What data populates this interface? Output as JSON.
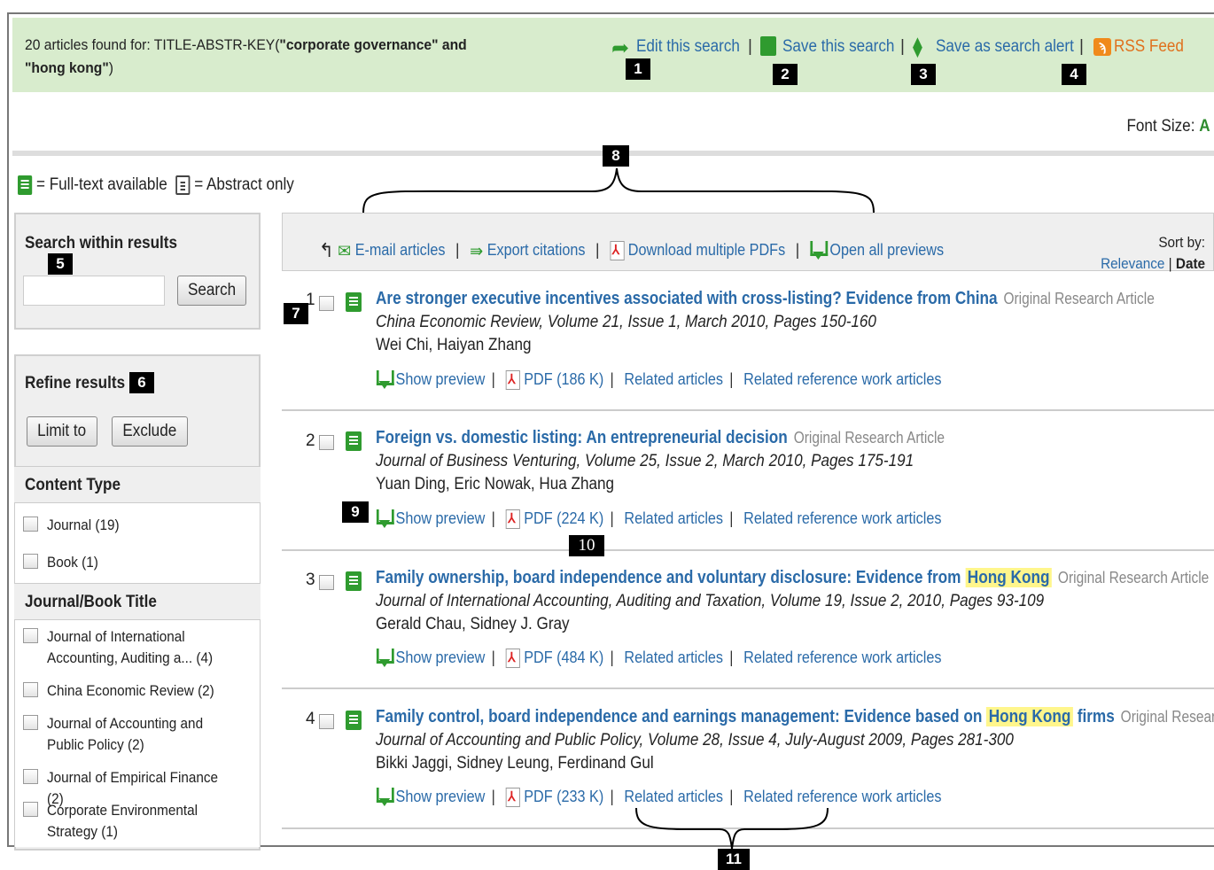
{
  "header": {
    "query_prefix": "20 articles found for: TITLE-ABSTR-KEY(",
    "query_terms": "\"corporate governance\" and \"hong kong\"",
    "query_suffix": ")",
    "edit_search": "Edit this search",
    "save_search": "Save this search",
    "save_alert": "Save as search alert",
    "rss_feed": "RSS Feed",
    "font_size_label": "Font Size:",
    "font_size_glyph": "A"
  },
  "legend": {
    "full_text": "= Full-text available",
    "abstract_only": "= Abstract only"
  },
  "sidebar": {
    "search_title": "Search within results",
    "search_placeholder": "",
    "search_button": "Search",
    "refine_title": "Refine results",
    "limit_button": "Limit to",
    "exclude_button": "Exclude",
    "content_type_title": "Content Type",
    "content_types": [
      "Journal (19)",
      "Book (1)"
    ],
    "journal_title_heading": "Journal/Book Title",
    "journals": [
      "Journal of International Accounting, Auditing a... (4)",
      "China Economic Review (2)",
      "Journal of Accounting and Public Policy (2)",
      "Journal of Empirical Finance (2)",
      "Corporate Environmental Strategy (1)"
    ]
  },
  "toolbar": {
    "email": "E-mail articles",
    "export": "Export citations",
    "download_pdfs": "Download multiple PDFs",
    "open_previews": "Open all previews",
    "sort_by": "Sort by:",
    "sort_relevance": "Relevance",
    "sort_date": "Date"
  },
  "results": [
    {
      "num": "1",
      "title_a": "Are stronger executive incentives associated with cross-listing? Evidence from China",
      "highlight": "",
      "title_b": "",
      "type": "Original Research Article",
      "source": "China Economic Review, Volume 21, Issue 1, March 2010, Pages 150-160",
      "authors": "Wei Chi, Haiyan Zhang",
      "preview": "Show preview",
      "pdf": "PDF (186 K)",
      "related": "Related articles",
      "related_ref": "Related reference work articles"
    },
    {
      "num": "2",
      "title_a": "Foreign vs. domestic listing: An entrepreneurial decision",
      "highlight": "",
      "title_b": "",
      "type": "Original Research Article",
      "source": "Journal of Business Venturing, Volume 25, Issue 2, March 2010, Pages 175-191",
      "authors": "Yuan Ding, Eric Nowak, Hua Zhang",
      "preview": "Show preview",
      "pdf": "PDF (224 K)",
      "related": "Related articles",
      "related_ref": "Related reference work articles"
    },
    {
      "num": "3",
      "title_a": "Family ownership, board independence and voluntary disclosure: Evidence from",
      "highlight": "Hong Kong",
      "title_b": "",
      "type": "Original Research Article",
      "source": "Journal of International Accounting, Auditing and Taxation, Volume 19, Issue 2, 2010, Pages 93-109",
      "authors": "Gerald Chau, Sidney J. Gray",
      "preview": "Show preview",
      "pdf": "PDF (484 K)",
      "related": "Related articles",
      "related_ref": "Related reference work articles"
    },
    {
      "num": "4",
      "title_a": "Family control, board independence and earnings management: Evidence based on",
      "highlight": "Hong Kong",
      "title_b": "firms",
      "type": "Original Research Article",
      "source": "Journal of Accounting and Public Policy, Volume 28, Issue 4, July-August 2009, Pages 281-300",
      "authors": "Bikki Jaggi, Sidney Leung, Ferdinand Gul",
      "preview": "Show preview",
      "pdf": "PDF (233 K)",
      "related": "Related articles",
      "related_ref": "Related reference work articles"
    }
  ],
  "annotations": [
    "1",
    "2",
    "3",
    "4",
    "5",
    "6",
    "7",
    "8",
    "9",
    "10",
    "11"
  ],
  "colors": {
    "link": "#2a6aa8",
    "topbar": "#d8eccd",
    "fulltext_icon": "#2f9b2f",
    "highlight": "#fff68c"
  }
}
